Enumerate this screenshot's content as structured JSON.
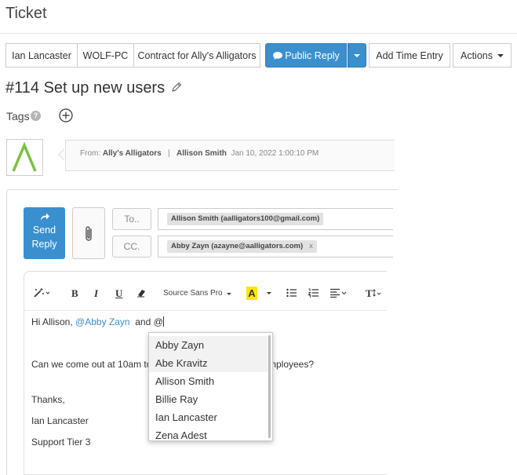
{
  "page": {
    "title": "Ticket"
  },
  "toolbar": {
    "customer": "Ian Lancaster",
    "asset": "WOLF-PC",
    "contract": "Contract for Ally's Alligators",
    "public_reply": "Public Reply",
    "add_time": "Add Time Entry",
    "actions": "Actions"
  },
  "ticket": {
    "title": "#114 Set up new users"
  },
  "tags": {
    "label": "Tags"
  },
  "message": {
    "from_label": "From:",
    "company": "Ally's Alligators",
    "separator": "|",
    "sender": "Allison Smith",
    "date": "Jan 10, 2022 1:00:10 PM"
  },
  "compose": {
    "send_line1": "Send",
    "send_line2": "Reply",
    "to_label": "To..",
    "cc_label": "CC.",
    "to_chip": "Allison Smith (aalligators100@gmail.com)",
    "cc_chip": "Abby Zayn (azayne@aalligators.com)",
    "cc_chip_remove": "x"
  },
  "editor": {
    "font_name": "Source Sans Pro",
    "bold": "B",
    "italic": "I",
    "underline": "U",
    "highlight": "A",
    "text_size": "T",
    "line1_prefix": "Hi Allison,",
    "line1_mention": "@Abby Zayn",
    "line1_suffix": "and @",
    "line2_start": "Can we come out at 10am to",
    "line2_end": "mployees?",
    "thanks": "Thanks,",
    "signature_name": "Ian Lancaster",
    "signature_title": "Support Tier 3"
  },
  "mention_dropdown": {
    "items": [
      "Abby Zayn",
      "Abe Kravitz",
      "Allison Smith",
      "Billie Ray",
      "Ian Lancaster",
      "Zena Adest"
    ]
  },
  "colors": {
    "primary": "#3a8fcf",
    "logo_green": "#7ac143",
    "highlight_yellow": "#ffe600",
    "mention": "#3a8fcf"
  }
}
